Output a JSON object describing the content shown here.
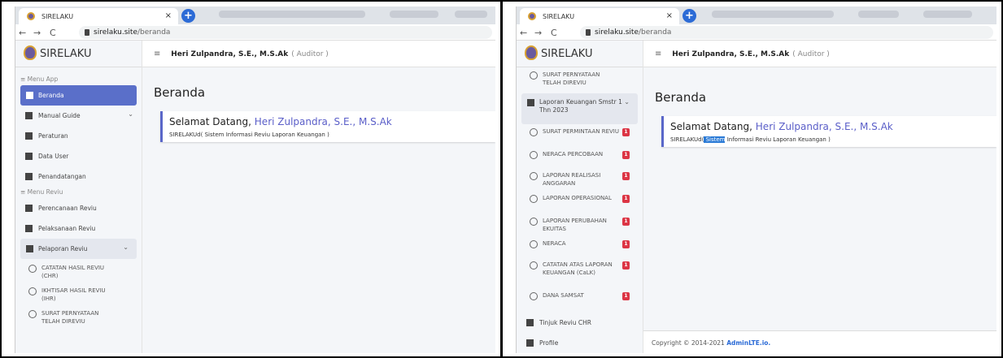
{
  "browser": {
    "tab_title": "SIRELAKU",
    "tab_close": "×",
    "new_tab": "+",
    "url_host": "sirelaku.site",
    "url_path": "/beranda"
  },
  "app": {
    "brand": "SIRELAKU",
    "topbar": {
      "menu_toggle": "≡",
      "user_name": "Heri Zulpandra, S.E., M.S.Ak",
      "user_role": "( Auditor )"
    },
    "page_title": "Beranda",
    "welcome_prefix": "Selamat Datang,",
    "welcome_name": "Heri Zulpandra, S.E., M.S.Ak",
    "welcome_sub": "SIRELAKUd( Sistem Informasi Reviu Laporan Keuangan )",
    "welcome_sub_a": "SIRELAKUd(",
    "welcome_sub_hl": " Sistem",
    "welcome_sub_b": " Informasi Reviu Laporan Keuangan )",
    "footer_prefix": "Copyright © 2014-2021",
    "footer_link": "AdminLTE.io."
  },
  "left_menu": {
    "section_app": "≡ Menu App",
    "beranda": "Beranda",
    "manual_guide": "Manual Guide",
    "peraturan": "Peraturan",
    "data_user": "Data User",
    "penandatangan": "Penandatangan",
    "section_reviu": "≡ Menu Reviu",
    "perencanaan": "Perencanaan Reviu",
    "pelaksanaan": "Pelaksanaan Reviu",
    "pelaporan": "Pelaporan Reviu",
    "chr": "CATATAN HASIL REVIU (CHR)",
    "ihr": "IKHTISAR HASIL REVIU (IHR)",
    "spr": "SURAT PERNYATAAN TELAH DIREVIU"
  },
  "right_menu": {
    "spr": "SURAT PERNYATAAN TELAH DIREVIU",
    "laporan_keuangan": "Laporan Keuangan Smstr 1 Thn 2023",
    "surat_permintaan": "SURAT PERMINTAAN REVIU",
    "neraca_percobaan": "NERACA PERCOBAAN",
    "lra": "LAPORAN REALISASI ANGGARAN",
    "lo": "LAPORAN OPERASIONAL",
    "lpe": "LAPORAN PERUBAHAN EKUITAS",
    "neraca": "NERACA",
    "calk": "CATATAN ATAS LAPORAN KEUANGAN (CaLK)",
    "dana_samsat": "DANA SAMSAT",
    "badge": "1",
    "tinjuk": "Tinjuk Reviu CHR",
    "profile": "Profile"
  },
  "colors": {
    "accent": "#5a6fc9",
    "badge": "#dc3545",
    "link": "#2a6ad6"
  }
}
